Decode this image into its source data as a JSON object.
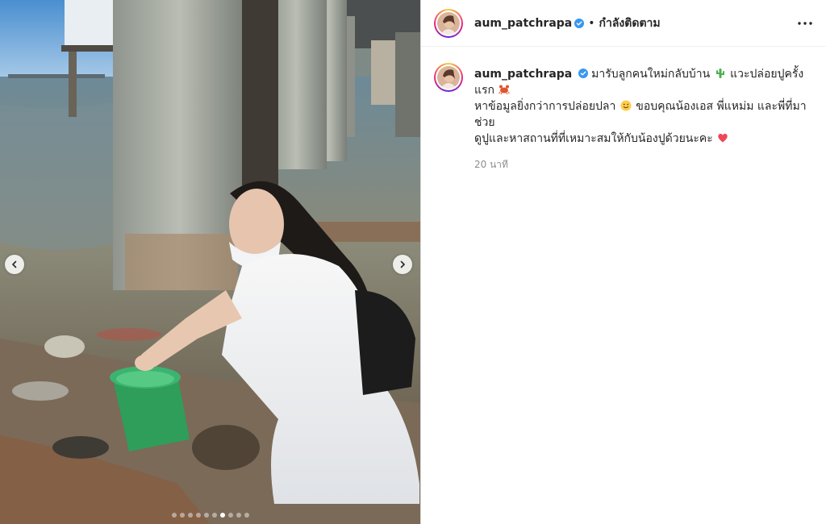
{
  "post": {
    "header": {
      "username": "aum_patchrapa",
      "separator": "•",
      "follow_status": "กำลังติดตาม"
    },
    "caption": {
      "username": "aum_patchrapa",
      "line1": "มารับลูกคนใหม่กลับบ้าน",
      "line1b": "แวะปล่อยปูครั้งแรก",
      "line2": "หาข้อมูลยิ่งกว่าการปล่อยปลา",
      "line2b": "ขอบคุณน้องเอส พี่แหม่ม และพี่ที่มาช่วย",
      "line3": "ดูปูและหาสถานที่ที่เหมาะสมให้กับน้องปูด้วยนะคะ",
      "time": "20 นาที"
    },
    "emoji_names": [
      "cactus-emoji",
      "crab-emoji",
      "smile-emoji",
      "red-heart-emoji"
    ],
    "carousel": {
      "total_slides": 10,
      "active_index": 6
    },
    "colors": {
      "verified": "#3897f0",
      "heart": "#ed4956",
      "bucket": "#3cb371"
    },
    "icons": [
      "chevron-left-icon",
      "chevron-right-icon",
      "more-options-icon",
      "verified-badge-icon"
    ]
  }
}
